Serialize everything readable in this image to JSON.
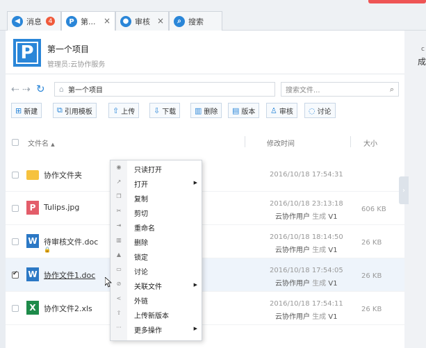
{
  "tabs": [
    {
      "label": "消息",
      "badge": "4",
      "icon": "message-icon",
      "glyph": "◀"
    },
    {
      "label": "第...",
      "icon": "project-p-icon",
      "glyph": "P"
    },
    {
      "label": "审核",
      "icon": "user-icon",
      "glyph": "●"
    },
    {
      "label": "搜索",
      "icon": "search-icon",
      "glyph": "⌕"
    }
  ],
  "project": {
    "logo": "P",
    "title": "第一个项目",
    "admin": "管理员:云协作服务"
  },
  "right_edge": {
    "t1": "c",
    "t2": "成"
  },
  "breadcrumb": {
    "text": "第一个项目"
  },
  "search": {
    "placeholder": "搜索文件..."
  },
  "toolbar": [
    {
      "label": "新建",
      "icon": "new-icon",
      "glyph": "⊞"
    },
    {
      "label": "引用模板",
      "icon": "template-icon",
      "glyph": "⧉"
    },
    {
      "label": "上传",
      "icon": "upload-icon",
      "glyph": "⇧"
    },
    {
      "label": "下载",
      "icon": "download-icon",
      "glyph": "⇩"
    },
    {
      "label": "删除",
      "icon": "trash-icon",
      "glyph": "▥"
    },
    {
      "label": "版本",
      "icon": "version-icon",
      "glyph": "▤"
    },
    {
      "label": "审核",
      "icon": "review-icon",
      "glyph": "♙"
    },
    {
      "label": "讨论",
      "icon": "discuss-icon",
      "glyph": "◌"
    }
  ],
  "table": {
    "headers": {
      "name": "文件名",
      "modified": "修改时间",
      "size": "大小"
    },
    "rows": [
      {
        "name": "协作文件夹",
        "type": "folder",
        "time": "2016/10/18 17:54:31",
        "uploader": "",
        "action": "",
        "version": "",
        "size": ""
      },
      {
        "name": "Tulips.jpg",
        "type": "ppt",
        "time": "2016/10/18 23:13:18",
        "uploader": "云协作用户",
        "action": "生成",
        "version": "V1",
        "size": "606 KB"
      },
      {
        "name": "待审核文件.doc",
        "type": "doc",
        "time": "2016/10/18 18:14:50",
        "uploader": "云协作用户",
        "action": "生成",
        "version": "V1",
        "size": "26 KB"
      },
      {
        "name": "协作文件1.doc",
        "type": "doc",
        "time": "2016/10/18 17:54:05",
        "uploader": "云协作用户",
        "action": "生成",
        "version": "V1",
        "size": "26 KB"
      },
      {
        "name": "协作文件2.xls",
        "type": "xls",
        "time": "2016/10/18 17:54:11",
        "uploader": "云协作用户",
        "action": "生成",
        "version": "V1",
        "size": "26 KB"
      }
    ]
  },
  "context_menu": [
    {
      "label": "只读打开",
      "icon": "eye-icon",
      "glyph": "◉"
    },
    {
      "label": "打开",
      "icon": "open-icon",
      "glyph": "↗",
      "submenu": true
    },
    {
      "label": "复制",
      "icon": "copy-icon",
      "glyph": "❐"
    },
    {
      "label": "剪切",
      "icon": "scissors-icon",
      "glyph": "✂"
    },
    {
      "label": "重命名",
      "icon": "rename-icon",
      "glyph": "⇥"
    },
    {
      "label": "删除",
      "icon": "trash-icon",
      "glyph": "▥"
    },
    {
      "label": "锁定",
      "icon": "lock-icon",
      "glyph": "▲"
    },
    {
      "label": "讨论",
      "icon": "comment-icon",
      "glyph": "▭"
    },
    {
      "label": "关联文件",
      "icon": "link-icon",
      "glyph": "⊘",
      "submenu": true
    },
    {
      "label": "外链",
      "icon": "share-icon",
      "glyph": "<"
    },
    {
      "label": "上传新版本",
      "icon": "upload-icon",
      "glyph": "⇧"
    },
    {
      "label": "更多操作",
      "icon": "more-icon",
      "glyph": "···",
      "submenu": true
    }
  ]
}
